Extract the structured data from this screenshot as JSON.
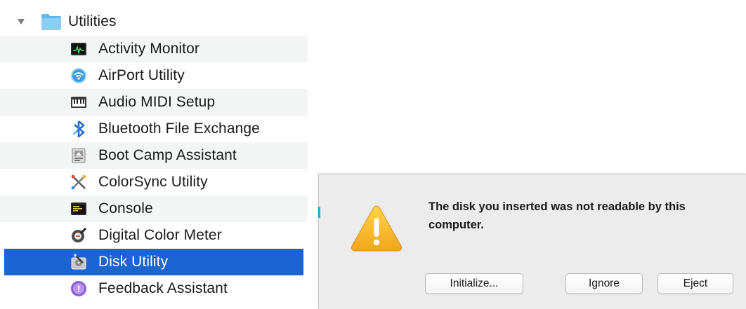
{
  "finder": {
    "folder": {
      "name": "Utilities",
      "icon": "folder-icon",
      "expanded": true
    },
    "items": [
      {
        "label": "Activity Monitor",
        "icon": "activity-monitor-icon"
      },
      {
        "label": "AirPort Utility",
        "icon": "airport-utility-icon"
      },
      {
        "label": "Audio MIDI Setup",
        "icon": "audio-midi-setup-icon"
      },
      {
        "label": "Bluetooth File Exchange",
        "icon": "bluetooth-icon"
      },
      {
        "label": "Boot Camp Assistant",
        "icon": "boot-camp-icon"
      },
      {
        "label": "ColorSync Utility",
        "icon": "colorsync-icon"
      },
      {
        "label": "Console",
        "icon": "console-icon"
      },
      {
        "label": "Digital Color Meter",
        "icon": "color-meter-icon"
      },
      {
        "label": "Disk Utility",
        "icon": "disk-utility-icon",
        "selected": true
      },
      {
        "label": "Feedback Assistant",
        "icon": "feedback-assistant-icon"
      }
    ],
    "selection_color": "#1b64d1"
  },
  "dialog": {
    "icon": "warning-icon",
    "message": "The disk you inserted was not readable by this computer.",
    "buttons": {
      "initialize": "Initialize...",
      "ignore": "Ignore",
      "eject": "Eject"
    }
  }
}
